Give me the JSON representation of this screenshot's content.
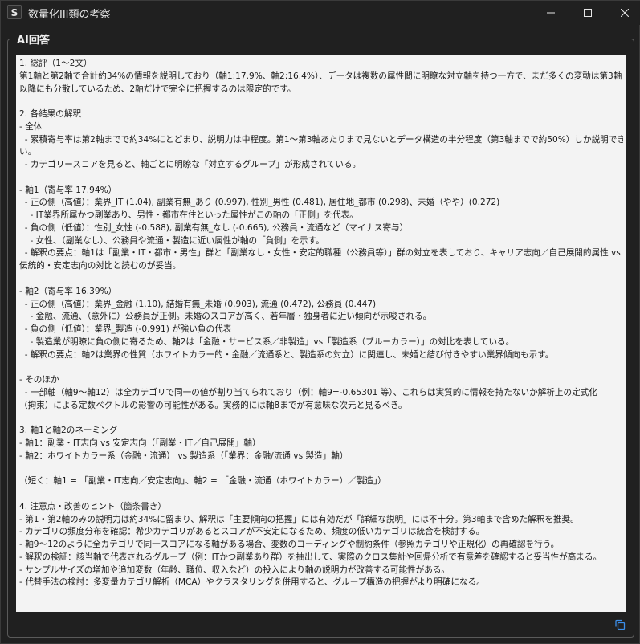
{
  "window": {
    "title": "数量化III類の考察",
    "app_icon_letter": "S",
    "minimize_icon": "minimize-icon",
    "maximize_icon": "maximize-icon",
    "close_icon": "close-icon"
  },
  "group": {
    "title": "AI回答"
  },
  "answer": {
    "lines": [
      "1. 総評（1〜2文）",
      "第1軸と第2軸で合計約34%の情報を説明しており（軸1:17.9%、軸2:16.4%）、データは複数の属性間に明瞭な対立軸を持つ一方で、まだ多くの変動は第3軸",
      "以降にも分散しているため、2軸だけで完全に把握するのは限定的です。",
      "",
      "2. 各結果の解釈",
      "- 全体",
      "  - 累積寄与率は第2軸までで約34%にとどまり、説明力は中程度。第1〜第3軸あたりまで見ないとデータ構造の半分程度（第3軸までで約50%）しか説明できな",
      "い。",
      "  - カテゴリースコアを見ると、軸ごとに明瞭な「対立するグループ」が形成されている。",
      "",
      "- 軸1（寄与率 17.94%）",
      "  - 正の側（高値）：業界_IT (1.04), 副業有無_あり (0.997), 性別_男性 (0.481), 居住地_都市 (0.298)、未婚（やや）(0.272)",
      "    - IT業界所属かつ副業あり、男性・都市在住といった属性がこの軸の「正側」を代表。",
      "  - 負の側（低値）：性別_女性 (-0.588), 副業有無_なし (-0.665), 公務員・流通など（マイナス寄与）",
      "    - 女性、（副業なし）、公務員や流通・製造に近い属性が軸の「負側」を示す。",
      "  - 解釈の要点：軸1は「副業・IT・都市・男性」群と「副業なし・女性・安定的職種（公務員等）」群の対立を表しており、キャリア志向／自己展開的属性 vs",
      "伝統的・安定志向の対比と読むのが妥当。",
      "",
      "- 軸2（寄与率 16.39%）",
      "  - 正の側（高値）：業界_金融 (1.10), 結婚有無_未婚 (0.903), 流通 (0.472), 公務員 (0.447)",
      "    - 金融、流通、（意外に）公務員が正側。未婚のスコアが高く、若年層・独身者に近い傾向が示唆される。",
      "  - 負の側（低値）：業界_製造 (-0.991) が強い負の代表",
      "    - 製造業が明瞭に負の側に寄るため、軸2は「金融・サービス系／非製造」vs「製造系（ブルーカラー）」の対比を表している。",
      "  - 解釈の要点：軸2は業界の性質（ホワイトカラー的・金融／流通系と、製造系の対立）に関連し、未婚と結び付きやすい業界傾向も示す。",
      "",
      "- そのほか",
      "  - 一部軸（軸9〜軸12）は全カテゴリで同一の値が割り当てられており（例：軸9=-0.65301 等）、これらは実質的に情報を持たないか解析上の定式化",
      "（拘束）による定数ベクトルの影響の可能性がある。実務的には軸8までが有意味な次元と見るべき。",
      "",
      "3. 軸1と軸2のネーミング",
      "- 軸1：副業・IT志向 vs 安定志向（「副業・IT／自己展開」軸）",
      "- 軸2：ホワイトカラー系（金融・流通） vs 製造系（「業界：金融/流通 vs 製造」軸）",
      "",
      "（短く：軸1 = 「副業・IT志向／安定志向」、軸2 = 「金融・流通（ホワイトカラー）／製造」）",
      "",
      "4. 注意点・改善のヒント（箇条書き）",
      "- 第1・第2軸のみの説明力は約34%に留まり、解釈は「主要傾向の把握」には有効だが「詳細な説明」には不十分。第3軸まで含めた解釈を推奨。",
      "- カテゴリの頻度分布を確認：希少カテゴリがあるとスコアが不安定になるため、頻度の低いカテゴリは統合を検討する。",
      "- 軸9〜12のように全カテゴリで同一スコアになる軸がある場合、変数のコーディングや制約条件（参照カテゴリや正規化）の再確認を行う。",
      "- 解釈の検証：該当軸で代表されるグループ（例：ITかつ副業あり群）を抽出して、実際のクロス集計や回帰分析で有意差を確認すると妥当性が高まる。",
      "- サンプルサイズの増加や追加変数（年齢、職位、収入など）の投入により軸の説明力が改善する可能性がある。",
      "- 代替手法の検討：多変量カテゴリ解析（MCA）やクラスタリングを併用すると、グループ構造の把握がより明確になる。"
    ]
  },
  "actions": {
    "copy_icon": "copy-icon",
    "accent_color": "#3b8eea"
  }
}
